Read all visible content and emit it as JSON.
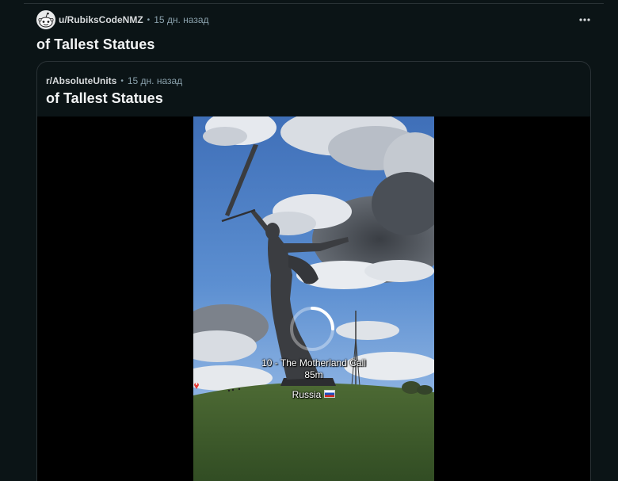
{
  "post": {
    "username": "u/RubiksCodeNMZ",
    "separator": "•",
    "time": "15 дн. назад",
    "title": "of Tallest Statues",
    "more_icon": "more-horizontal-icon"
  },
  "crosspost": {
    "subreddit": "r/AbsoluteUnits",
    "separator": "•",
    "time": "15 дн. назад",
    "title": "of Tallest Statues"
  },
  "video": {
    "caption_line1": "10 - The Motherland Call",
    "caption_line2": "85m",
    "caption_line3": "Russia",
    "location_icon": "location-pin-icon",
    "flag_icon": "russia-flag-icon",
    "loading_icon": "loading-spinner-icon"
  },
  "colors": {
    "background": "#0b1416",
    "text_primary": "#f2f4f5",
    "text_secondary": "#8ba2ad",
    "border": "#2a3236"
  }
}
